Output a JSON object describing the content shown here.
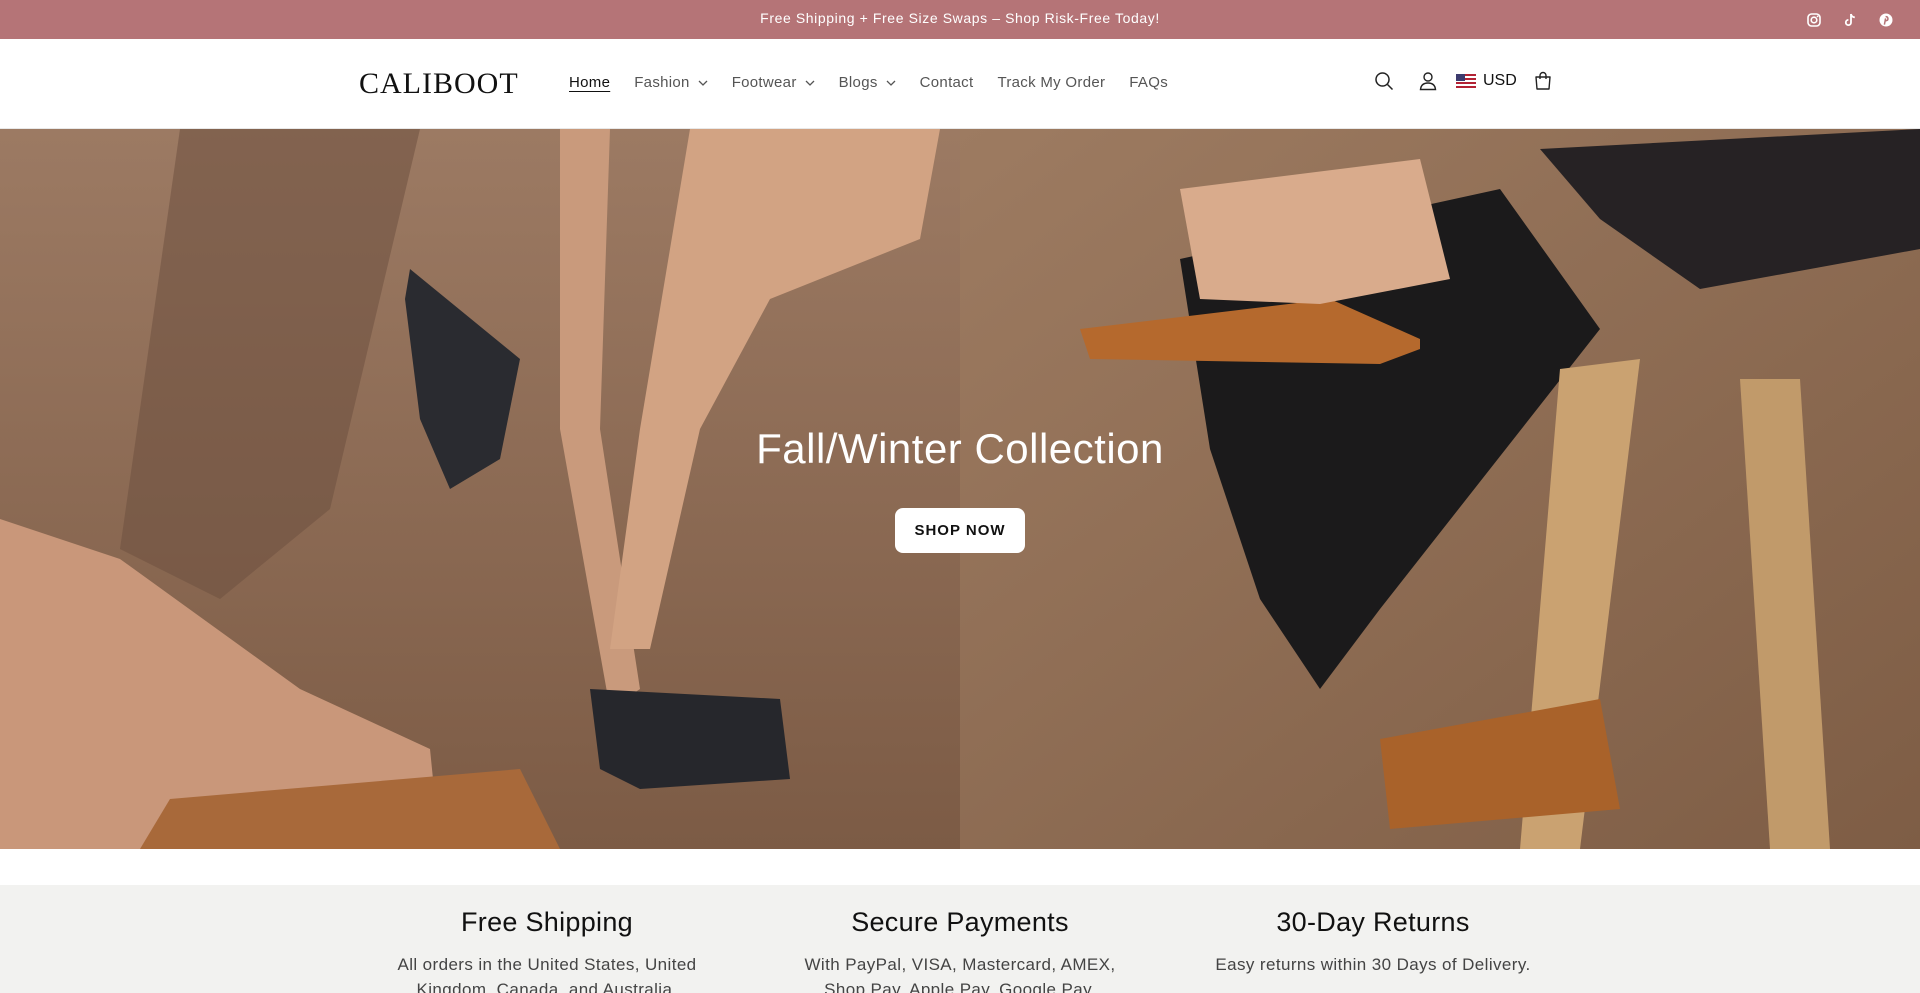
{
  "announcement": {
    "text": "Free Shipping + Free Size Swaps – Shop Risk-Free Today!",
    "background": "#b57477"
  },
  "social_icons": [
    "instagram-icon",
    "tiktok-icon",
    "pinterest-icon"
  ],
  "header": {
    "logo": "CALIBOOT",
    "nav": [
      {
        "label": "Home",
        "active": true
      },
      {
        "label": "Fashion",
        "dropdown": true
      },
      {
        "label": "Footwear",
        "dropdown": true
      },
      {
        "label": "Blogs",
        "dropdown": true
      },
      {
        "label": "Contact"
      },
      {
        "label": "Track My Order"
      },
      {
        "label": "FAQs"
      }
    ],
    "icons": [
      "search-icon",
      "account-icon",
      "cart-icon"
    ],
    "currency": "USD"
  },
  "hero": {
    "title": "Fall/Winter Collection",
    "button": "SHOP NOW"
  },
  "features": [
    {
      "title": "Free Shipping",
      "text": "All orders in the United States, United Kingdom, Canada, and Australia."
    },
    {
      "title": "Secure Payments",
      "text": "With PayPal, VISA, Mastercard, AMEX, Shop Pay, Apple Pay, Google Pay."
    },
    {
      "title": "30-Day Returns",
      "text": "Easy returns within 30 Days of Delivery."
    }
  ]
}
